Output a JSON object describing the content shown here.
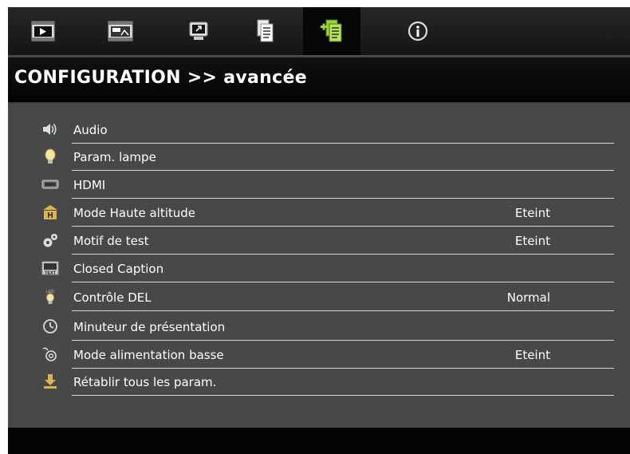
{
  "window": {
    "title": "CONFIGURATION >> avancée"
  },
  "tabs": [
    {
      "icon": "image-icon",
      "active": false
    },
    {
      "icon": "display-icon",
      "active": false
    },
    {
      "icon": "screen-icon",
      "active": false
    },
    {
      "icon": "setup-icon",
      "active": false
    },
    {
      "icon": "advanced-setup-icon",
      "active": true
    },
    {
      "icon": "info-icon",
      "active": false
    }
  ],
  "menu": {
    "items": [
      {
        "label": "Audio",
        "value": "",
        "icon": "speaker-icon"
      },
      {
        "label": "Param. lampe",
        "value": "",
        "icon": "lamp-icon"
      },
      {
        "label": "HDMI",
        "value": "",
        "icon": "hdmi-icon"
      },
      {
        "label": "Mode Haute altitude",
        "value": "Eteint",
        "icon": "high-altitude-icon"
      },
      {
        "label": "Motif de test",
        "value": "Eteint",
        "icon": "gears-icon"
      },
      {
        "label": "Closed Caption",
        "value": "",
        "icon": "text-caption-icon"
      },
      {
        "label": "Contrôle DEL",
        "value": "Normal",
        "icon": "led-icon"
      },
      {
        "label": "Minuteur de présentation",
        "value": "",
        "icon": "timer-icon"
      },
      {
        "label": "Mode alimentation basse",
        "value": "Eteint",
        "icon": "low-power-icon"
      },
      {
        "label": "Rétablir tous les param.",
        "value": "",
        "icon": "reset-download-icon"
      }
    ]
  },
  "colors": {
    "active_tab_icon": "#9bd13a",
    "content_bg": "#484848",
    "text": "#ffffff"
  }
}
